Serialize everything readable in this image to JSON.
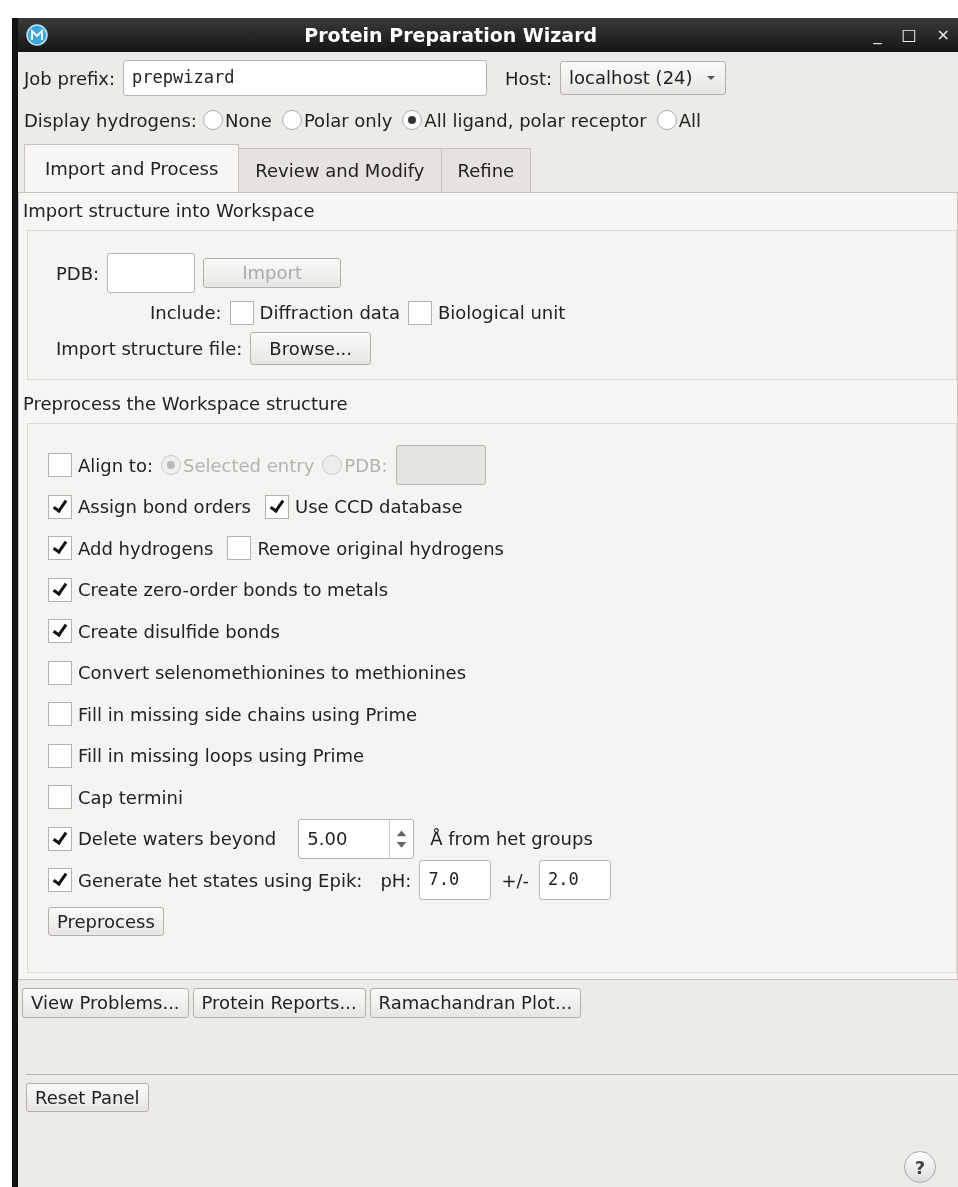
{
  "window": {
    "title": "Protein Preparation Wizard",
    "controls": [
      "_",
      "□",
      "×"
    ]
  },
  "job_prefix": {
    "label": "Job prefix:",
    "value": "prepwizard"
  },
  "host": {
    "label": "Host:",
    "value": "localhost (24)"
  },
  "display_hydrogens": {
    "label": "Display hydrogens:",
    "options": [
      {
        "label": "None",
        "selected": false
      },
      {
        "label": "Polar only",
        "selected": false
      },
      {
        "label": "All ligand, polar receptor",
        "selected": true
      },
      {
        "label": "All",
        "selected": false
      }
    ]
  },
  "tabs": [
    {
      "label": "Import and Process",
      "selected": true
    },
    {
      "label": "Review and Modify",
      "selected": false
    },
    {
      "label": "Refine",
      "selected": false
    }
  ],
  "import_section": {
    "title": "Import structure into Workspace",
    "pdb_label": "PDB:",
    "import_button": {
      "label": "Import",
      "disabled": true
    },
    "include_label": "Include:",
    "include_options": [
      {
        "label": "Diffraction data",
        "checked": false
      },
      {
        "label": "Biological unit",
        "checked": false
      }
    ],
    "file_label": "Import structure file:",
    "browse_button": "Browse..."
  },
  "preprocess_section": {
    "title": "Preprocess the Workspace structure",
    "rows": [
      {
        "kind": "align",
        "label": "Align to:",
        "checked": false,
        "disabled": true,
        "options": [
          {
            "label": "Selected entry",
            "selected": true
          },
          {
            "label": "PDB:",
            "selected": false
          }
        ]
      },
      {
        "kind": "checks",
        "items": [
          {
            "label": "Assign bond orders",
            "checked": true
          },
          {
            "label": "Use CCD database",
            "checked": true
          }
        ]
      },
      {
        "kind": "checks",
        "items": [
          {
            "label": "Add hydrogens",
            "checked": true
          },
          {
            "label": "Remove original hydrogens",
            "checked": false
          }
        ]
      },
      {
        "kind": "checks",
        "items": [
          {
            "label": "Create zero-order bonds to metals",
            "checked": true
          }
        ]
      },
      {
        "kind": "checks",
        "items": [
          {
            "label": "Create disulfide bonds",
            "checked": true
          }
        ]
      },
      {
        "kind": "checks",
        "items": [
          {
            "label": "Convert selenomethionines to methionines",
            "checked": false
          }
        ]
      },
      {
        "kind": "checks",
        "items": [
          {
            "label": "Fill in missing side chains using Prime",
            "checked": false
          }
        ]
      },
      {
        "kind": "checks",
        "items": [
          {
            "label": "Fill in missing loops using Prime",
            "checked": false
          }
        ]
      },
      {
        "kind": "checks",
        "items": [
          {
            "label": "Cap termini",
            "checked": false
          }
        ]
      },
      {
        "kind": "spin",
        "label": "Delete waters beyond",
        "checked": true,
        "value": "5.00",
        "suffix": "Å from het groups"
      },
      {
        "kind": "epik",
        "label": "Generate het states using Epik:",
        "checked": true,
        "ph_label": "pH:",
        "ph_value": "7.0",
        "pm_label": "+/-",
        "pm_value": "2.0"
      },
      {
        "kind": "button",
        "label": "Preprocess"
      }
    ]
  },
  "tool_buttons": [
    "View Problems...",
    "Protein Reports...",
    "Ramachandran Plot..."
  ],
  "reset_button": "Reset Panel",
  "help": "?"
}
